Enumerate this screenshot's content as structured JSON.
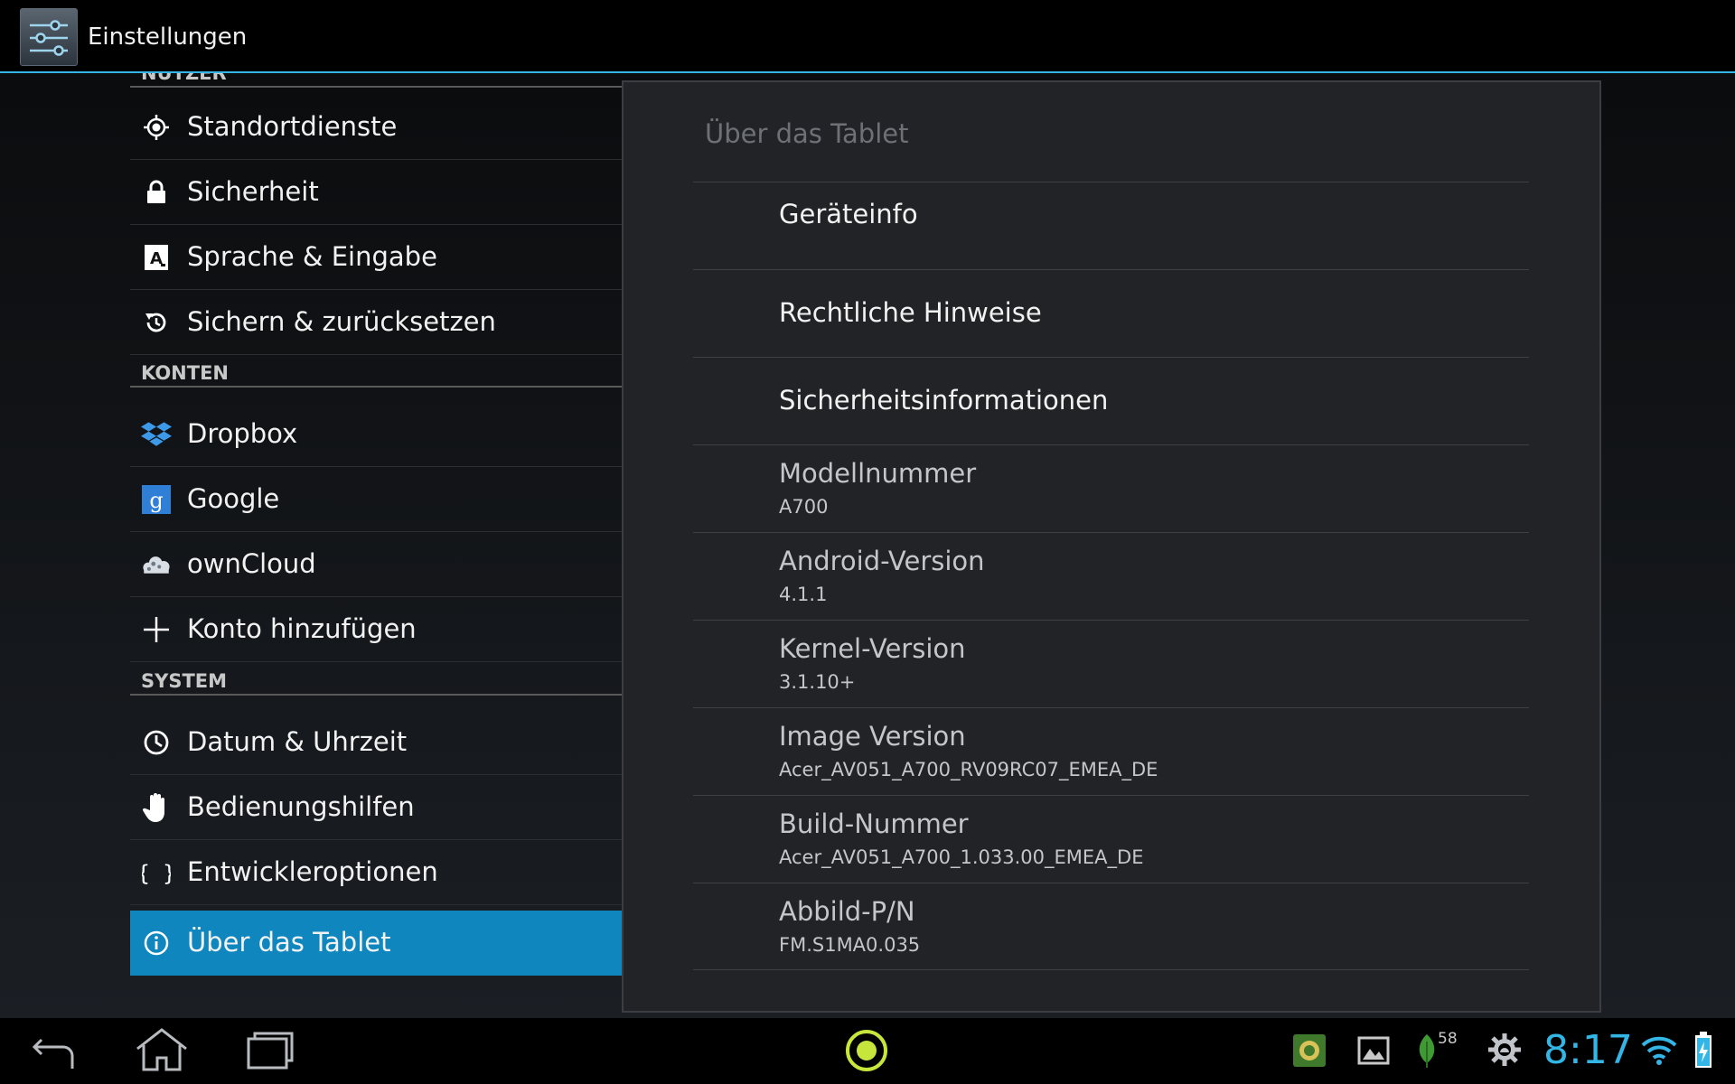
{
  "header": {
    "title": "Einstellungen",
    "icon": "settings-sliders-icon"
  },
  "sidebar": {
    "sections": [
      {
        "label": "NUTZER"
      },
      {
        "label": "KONTEN"
      },
      {
        "label": "SYSTEM"
      }
    ],
    "items": [
      {
        "label": "Standortdienste",
        "icon": "location-icon"
      },
      {
        "label": "Sicherheit",
        "icon": "lock-icon"
      },
      {
        "label": "Sprache & Eingabe",
        "icon": "language-icon"
      },
      {
        "label": "Sichern & zurücksetzen",
        "icon": "backup-restore-icon"
      },
      {
        "label": "Dropbox",
        "icon": "dropbox-icon"
      },
      {
        "label": "Google",
        "icon": "google-icon"
      },
      {
        "label": "ownCloud",
        "icon": "owncloud-icon"
      },
      {
        "label": "Konto hinzufügen",
        "icon": "plus-icon"
      },
      {
        "label": "Datum & Uhrzeit",
        "icon": "clock-icon"
      },
      {
        "label": "Bedienungshilfen",
        "icon": "hand-icon"
      },
      {
        "label": "Entwickleroptionen",
        "icon": "braces-icon"
      },
      {
        "label": "Über das Tablet",
        "icon": "info-icon",
        "selected": true
      }
    ]
  },
  "detail": {
    "title": "Über das Tablet",
    "items": [
      {
        "label": "Geräteinfo"
      },
      {
        "label": "Rechtliche Hinweise"
      },
      {
        "label": "Sicherheitsinformationen"
      },
      {
        "label": "Modellnummer",
        "value": "A700"
      },
      {
        "label": "Android-Version",
        "value": "4.1.1"
      },
      {
        "label": "Kernel-Version",
        "value": "3.1.10+"
      },
      {
        "label": "Image Version",
        "value": "Acer_AV051_A700_RV09RC07_EMEA_DE"
      },
      {
        "label": "Build-Nummer",
        "value": "Acer_AV051_A700_1.033.00_EMEA_DE"
      },
      {
        "label": "Abbild-P/N",
        "value": "FM.S1MA0.035"
      }
    ]
  },
  "status": {
    "time": "8:17",
    "notification_count": "58"
  },
  "colors": {
    "accent": "#33b5e5",
    "selected": "#0f86bd",
    "background": "#000000"
  }
}
